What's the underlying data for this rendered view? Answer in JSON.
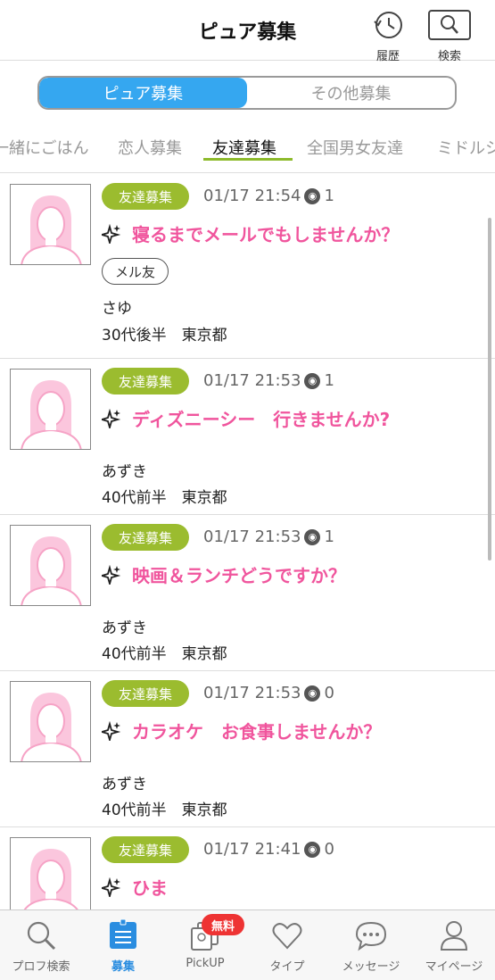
{
  "header": {
    "title": "ピュア募集",
    "history_label": "履歴",
    "search_label": "検索"
  },
  "segments": [
    "ピュア募集",
    "その他募集"
  ],
  "categories": [
    "一緒にごはん",
    "恋人募集",
    "友達募集",
    "全国男女友達",
    "ミドルシ"
  ],
  "posts": [
    {
      "badge": "友達募集",
      "datetime": "01/17 21:54",
      "views": "1",
      "title": "寝るまでメールでもしませんか？",
      "tag": "メル友",
      "name": "さゆ",
      "age_area": "30代後半　東京都"
    },
    {
      "badge": "友達募集",
      "datetime": "01/17 21:53",
      "views": "1",
      "title": "ディズニーシー　行きませんか?",
      "name": "あずき",
      "age_area": "40代前半　東京都"
    },
    {
      "badge": "友達募集",
      "datetime": "01/17 21:53",
      "views": "1",
      "title": "映画＆ランチどうですか？",
      "name": "あずき",
      "age_area": "40代前半　東京都"
    },
    {
      "badge": "友達募集",
      "datetime": "01/17 21:53",
      "views": "0",
      "title": "カラオケ　お食事しませんか？",
      "name": "あずき",
      "age_area": "40代前半　東京都"
    },
    {
      "badge": "友達募集",
      "datetime": "01/17 21:41",
      "views": "0",
      "title": "ひま"
    }
  ],
  "bottom_nav": {
    "items": [
      "プロフ検索",
      "募集",
      "PickUP",
      "タイプ",
      "メッセージ",
      "マイページ"
    ],
    "free_badge": "無料"
  },
  "colors": {
    "accent_blue": "#35a7f0",
    "badge_green": "#9bbc2f",
    "title_pink": "#f0559d",
    "nav_active": "#2a8de0"
  }
}
